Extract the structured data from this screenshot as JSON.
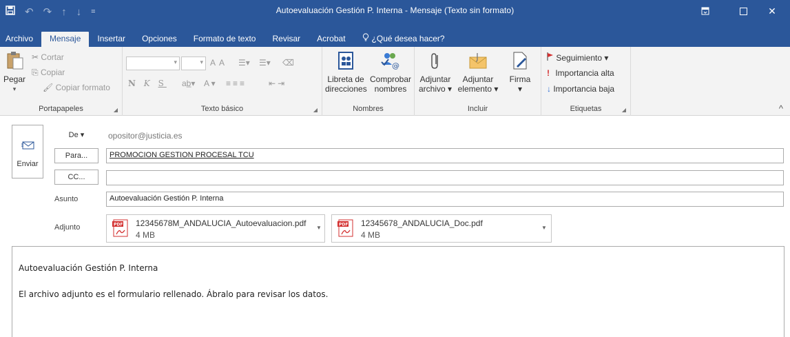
{
  "window": {
    "title": "Autoevaluación Gestión P. Interna  -  Mensaje (Texto sin formato)",
    "controls": {
      "ribbon_display": "⊡",
      "maximize": "☐",
      "close": "✕"
    }
  },
  "qat": {
    "save": "🖫",
    "undo": "↶",
    "redo": "↷",
    "up": "↑",
    "down": "↓",
    "customize": "="
  },
  "tabs": {
    "file": "Archivo",
    "items": [
      "Mensaje",
      "Insertar",
      "Opciones",
      "Formato de texto",
      "Revisar",
      "Acrobat"
    ],
    "tell_me": "¿Qué desea hacer?"
  },
  "ribbon": {
    "portapapeles": {
      "label": "Portapapeles",
      "paste": "Pegar",
      "cut": "Cortar",
      "copy": "Copiar",
      "copy_format": "Copiar formato"
    },
    "texto_basico": {
      "label": "Texto básico",
      "bold": "N",
      "italic": "K",
      "underline": "S"
    },
    "nombres": {
      "label": "Nombres",
      "address_book_1": "Libreta de",
      "address_book_2": "direcciones",
      "check_names_1": "Comprobar",
      "check_names_2": "nombres"
    },
    "incluir": {
      "label": "Incluir",
      "attach_file_1": "Adjuntar",
      "attach_file_2": "archivo ▾",
      "attach_item_1": "Adjuntar",
      "attach_item_2": "elemento ▾",
      "signature_1": "Firma",
      "signature_2": "▾"
    },
    "etiquetas": {
      "label": "Etiquetas",
      "follow_up": "Seguimiento ▾",
      "high_importance": "Importancia alta",
      "low_importance": "Importancia baja"
    },
    "collapse": "^"
  },
  "form": {
    "send": "Enviar",
    "from_button": "De ▾",
    "from_value": "opositor@justicia.es",
    "to_button": "Para...",
    "to_value": "PROMOCION GESTION PROCESAL TCU",
    "cc_button": "CC...",
    "cc_value": "",
    "subject_label": "Asunto",
    "subject_value": "Autoevaluación Gestión P. Interna",
    "attach_label": "Adjunto",
    "attachments": [
      {
        "name": "12345678M_ANDALUCIA_Autoevaluacion.pdf",
        "size": "4 MB"
      },
      {
        "name": "12345678_ANDALUCIA_Doc.pdf",
        "size": "4 MB"
      }
    ]
  },
  "body": {
    "line1": "Autoevaluación Gestión P. Interna",
    "line2": "El archivo adjunto es el formulario rellenado. Ábralo para revisar los datos."
  },
  "colors": {
    "accent": "#2b579a",
    "ribbon_bg": "#f3f3f3",
    "red_flag": "#d32f2f",
    "blue_arrow": "#2b6cd4"
  }
}
